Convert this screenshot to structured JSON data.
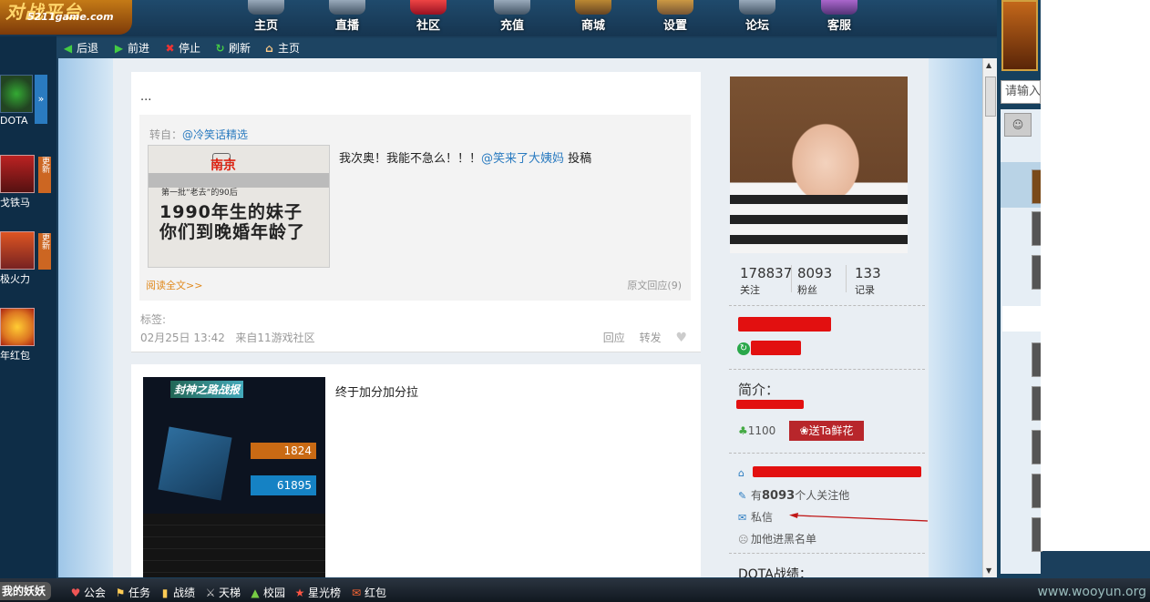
{
  "logo": {
    "main": "对战平台",
    "url": "5211game.com"
  },
  "nav": [
    {
      "label": "主页",
      "icon": "home-icon"
    },
    {
      "label": "直播",
      "icon": "tv-icon"
    },
    {
      "label": "社区",
      "icon": "community-icon"
    },
    {
      "label": "充值",
      "icon": "recharge-icon"
    },
    {
      "label": "商城",
      "icon": "shop-icon"
    },
    {
      "label": "设置",
      "icon": "gear-icon"
    },
    {
      "label": "论坛",
      "icon": "forum-icon"
    },
    {
      "label": "客服",
      "icon": "support-icon"
    }
  ],
  "toolbar": {
    "back": "后退",
    "forward": "前进",
    "stop": "停止",
    "refresh": "刷新",
    "home": "主页"
  },
  "left_games": [
    {
      "label": "DOTA"
    },
    {
      "label": "戈铁马",
      "badge": "更新"
    },
    {
      "label": "极火力",
      "badge": "更新"
    },
    {
      "label": "年红包"
    }
  ],
  "post1": {
    "text": "...",
    "repost_prefix": "转自：",
    "repost_user": "@冷笑话精选",
    "image": {
      "city": "南京",
      "line0": "第一批“老去”的90后",
      "line1": "1990年生的妹子",
      "line2": "你们到晚婚年龄了"
    },
    "repost_text": "我次奥！我能不急么！！！",
    "repost_at": "@笑来了大姨妈",
    "repost_suffix": "投稿",
    "read_all": "阅读全文>>",
    "orig_reply": "原文回应(9)",
    "tags_label": "标签:",
    "meta": "02月25日 13:42   来自11游戏社区",
    "reply": "回应",
    "forward": "转发"
  },
  "post2": {
    "text": "终于加分加分拉",
    "image": {
      "title": "封神之路战报",
      "score1": "1824",
      "score2": "61895"
    }
  },
  "profile": {
    "stats": [
      {
        "num": "178837",
        "label": "关注"
      },
      {
        "num": "8093",
        "label": "粉丝"
      },
      {
        "num": "133",
        "label": "记录"
      }
    ],
    "intro_label": "简介：",
    "flowers": "1100",
    "send_flower": "送Ta鲜花",
    "followers_prefix": "有",
    "followers_count": "8093",
    "followers_suffix": "个人关注他",
    "message": "私信",
    "blacklist": "加他进黑名单",
    "dota_label": "DOTA战绩："
  },
  "right_panel": {
    "search_placeholder": "请输入"
  },
  "bottombar": {
    "me": "我的妖妖",
    "items": [
      {
        "label": "公会",
        "icon": "guild-icon"
      },
      {
        "label": "任务",
        "icon": "task-icon"
      },
      {
        "label": "战绩",
        "icon": "stats-icon"
      },
      {
        "label": "天梯",
        "icon": "ladder-icon"
      },
      {
        "label": "校园",
        "icon": "campus-icon"
      },
      {
        "label": "星光榜",
        "icon": "star-icon"
      },
      {
        "label": "红包",
        "icon": "redpacket-icon"
      }
    ],
    "watermark": "www.wooyun.org"
  }
}
